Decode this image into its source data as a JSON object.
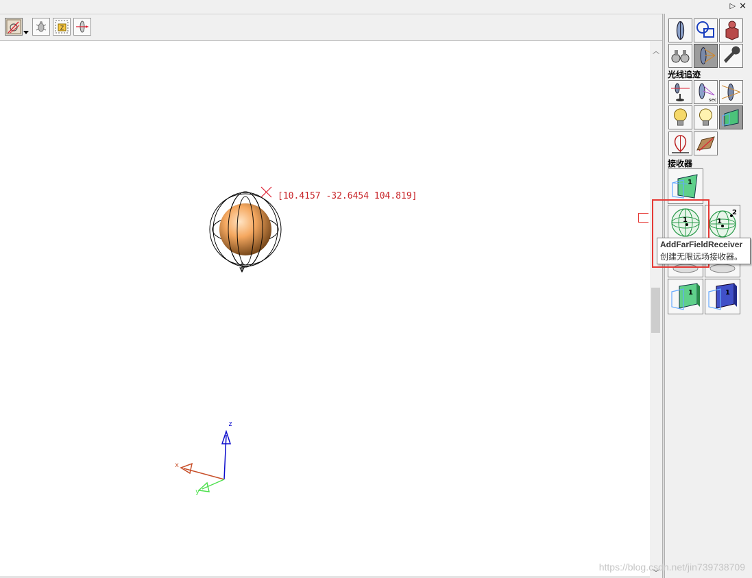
{
  "window": {
    "pin_glyph": "▷",
    "close_glyph": "✕"
  },
  "toolbar": {
    "buttons": [
      {
        "icon": "ray-select-icon",
        "pressed": true
      },
      {
        "icon": "bug-icon",
        "pressed": false
      },
      {
        "icon": "z-select-icon",
        "pressed": false
      },
      {
        "icon": "lens-ray-icon",
        "pressed": false
      }
    ]
  },
  "viewport": {
    "coordinate_readout": "[10.4157 -32.6454 104.819]",
    "axes": {
      "x": "x",
      "y": "y",
      "z": "z"
    },
    "object_color": "#f5a860",
    "axis_colors": {
      "x": "#c8502a",
      "y": "#4de04d",
      "z": "#0a0acc"
    }
  },
  "panel": {
    "section_ray_trace": "光线追迹",
    "section_receiver": "接收器",
    "receiver_buttons": [
      {
        "name": "add-far-field-receiver",
        "badge": "1"
      },
      {
        "name": "add-far-field-receiver-2",
        "badge": "2"
      }
    ],
    "plane_receiver_badges": [
      "1",
      "1",
      "1"
    ]
  },
  "tooltip": {
    "title": "AddFarFieldReceiver",
    "description": "创建无限远场接收器。"
  },
  "watermark": "https://blog.csdn.net/jin739738709",
  "accent": "#e53935"
}
